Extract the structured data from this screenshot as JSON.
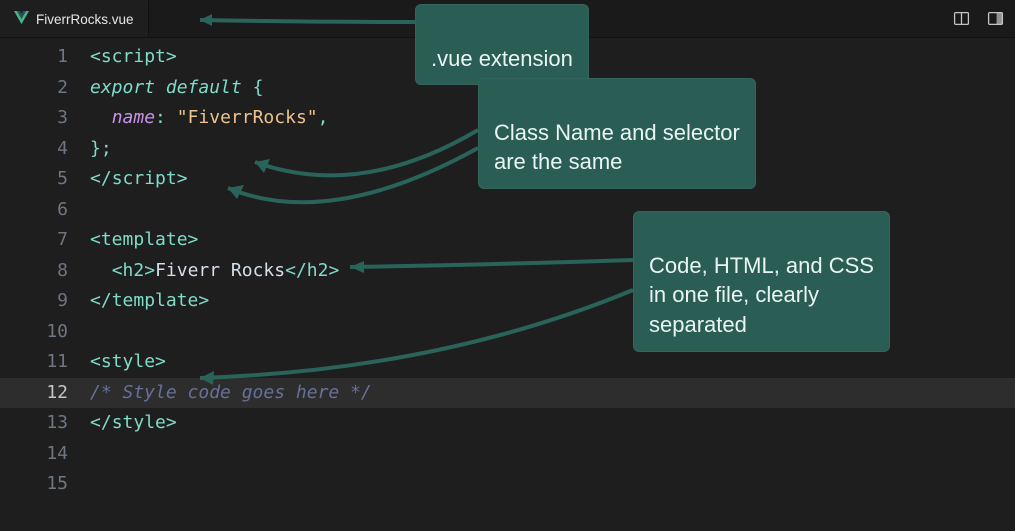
{
  "tab": {
    "filename": "FiverrRocks.vue",
    "icon": "vue-logo-icon"
  },
  "toolbar": {
    "layout_icon": "split-horizontal-icon",
    "preview_icon": "preview-panel-icon"
  },
  "editor": {
    "highlighted_line": 12,
    "lines": [
      {
        "n": 1,
        "tokens": [
          {
            "t": "<",
            "c": "s-punc"
          },
          {
            "t": "script",
            "c": "s-tag"
          },
          {
            "t": ">",
            "c": "s-punc"
          }
        ]
      },
      {
        "n": 2,
        "tokens": [
          {
            "t": "export",
            "c": "s-keyw"
          },
          {
            "t": " ",
            "c": "s-plain"
          },
          {
            "t": "default",
            "c": "s-keyw"
          },
          {
            "t": " ",
            "c": "s-plain"
          },
          {
            "t": "{",
            "c": "s-punc"
          }
        ]
      },
      {
        "n": 3,
        "tokens": [
          {
            "t": "  ",
            "c": "s-plain"
          },
          {
            "t": "name",
            "c": "s-key"
          },
          {
            "t": ":",
            "c": "s-punc"
          },
          {
            "t": " ",
            "c": "s-plain"
          },
          {
            "t": "\"FiverrRocks\"",
            "c": "s-str"
          },
          {
            "t": ",",
            "c": "s-punc"
          }
        ]
      },
      {
        "n": 4,
        "tokens": [
          {
            "t": "};",
            "c": "s-punc"
          }
        ]
      },
      {
        "n": 5,
        "tokens": [
          {
            "t": "</",
            "c": "s-punc"
          },
          {
            "t": "script",
            "c": "s-tag"
          },
          {
            "t": ">",
            "c": "s-punc"
          }
        ]
      },
      {
        "n": 6,
        "tokens": []
      },
      {
        "n": 7,
        "tokens": [
          {
            "t": "<",
            "c": "s-punc"
          },
          {
            "t": "template",
            "c": "s-tag"
          },
          {
            "t": ">",
            "c": "s-punc"
          }
        ]
      },
      {
        "n": 8,
        "tokens": [
          {
            "t": "  ",
            "c": "s-plain"
          },
          {
            "t": "<",
            "c": "s-punc"
          },
          {
            "t": "h2",
            "c": "s-tag"
          },
          {
            "t": ">",
            "c": "s-punc"
          },
          {
            "t": "Fiverr Rocks",
            "c": "s-h2txt"
          },
          {
            "t": "</",
            "c": "s-punc"
          },
          {
            "t": "h2",
            "c": "s-tag"
          },
          {
            "t": ">",
            "c": "s-punc"
          }
        ]
      },
      {
        "n": 9,
        "tokens": [
          {
            "t": "</",
            "c": "s-punc"
          },
          {
            "t": "template",
            "c": "s-tag"
          },
          {
            "t": ">",
            "c": "s-punc"
          }
        ]
      },
      {
        "n": 10,
        "tokens": []
      },
      {
        "n": 11,
        "tokens": [
          {
            "t": "<",
            "c": "s-punc"
          },
          {
            "t": "style",
            "c": "s-tag"
          },
          {
            "t": ">",
            "c": "s-punc"
          }
        ]
      },
      {
        "n": 12,
        "tokens": [
          {
            "t": "/* Style code goes here */",
            "c": "s-cmt"
          }
        ]
      },
      {
        "n": 13,
        "tokens": [
          {
            "t": "</",
            "c": "s-punc"
          },
          {
            "t": "style",
            "c": "s-tag"
          },
          {
            "t": ">",
            "c": "s-punc"
          }
        ]
      },
      {
        "n": 14,
        "tokens": []
      },
      {
        "n": 15,
        "tokens": []
      }
    ]
  },
  "annotations": {
    "ext": {
      "text": ".vue extension"
    },
    "class": {
      "text": "Class Name and selector\nare the same"
    },
    "onefile": {
      "text": "Code, HTML, and CSS\nin one file, clearly\nseparated"
    }
  }
}
